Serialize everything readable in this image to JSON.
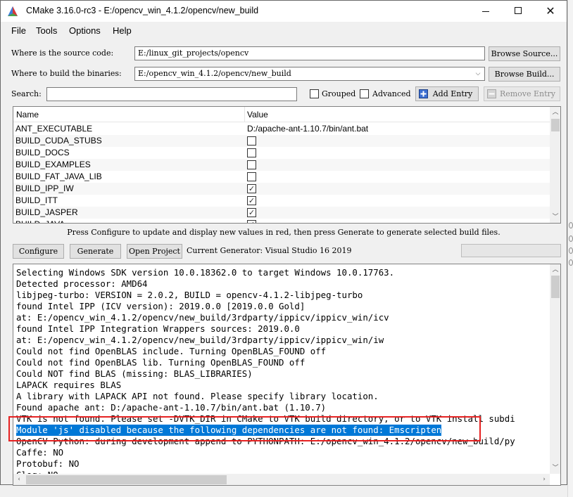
{
  "window": {
    "title": "CMake 3.16.0-rc3 - E:/opencv_win_4.1.2/opencv/new_build"
  },
  "menu": {
    "items": [
      "File",
      "Tools",
      "Options",
      "Help"
    ]
  },
  "source": {
    "label": "Where is the source code:",
    "value": "E:/linux_git_projects/opencv",
    "browse_label": "Browse Source..."
  },
  "build": {
    "label": "Where to build the binaries:",
    "value": "E:/opencv_win_4.1.2/opencv/new_build",
    "browse_label": "Browse Build..."
  },
  "search": {
    "label": "Search:",
    "value": ""
  },
  "options": {
    "grouped_label": "Grouped",
    "advanced_label": "Advanced",
    "add_entry_label": "Add Entry",
    "remove_entry_label": "Remove Entry"
  },
  "cache": {
    "col_name": "Name",
    "col_value": "Value",
    "rows": [
      {
        "name": "ANT_EXECUTABLE",
        "value": "D:/apache-ant-1.10.7/bin/ant.bat",
        "type": "path"
      },
      {
        "name": "BUILD_CUDA_STUBS",
        "checked": false,
        "type": "bool"
      },
      {
        "name": "BUILD_DOCS",
        "checked": false,
        "type": "bool"
      },
      {
        "name": "BUILD_EXAMPLES",
        "checked": false,
        "type": "bool"
      },
      {
        "name": "BUILD_FAT_JAVA_LIB",
        "checked": false,
        "type": "bool"
      },
      {
        "name": "BUILD_IPP_IW",
        "checked": true,
        "type": "bool"
      },
      {
        "name": "BUILD_ITT",
        "checked": true,
        "type": "bool"
      },
      {
        "name": "BUILD_JASPER",
        "checked": true,
        "type": "bool"
      },
      {
        "name": "BUILD_JAVA",
        "checked": true,
        "type": "bool"
      }
    ]
  },
  "hint": "Press Configure to update and display new values in red, then press Generate to generate selected build files.",
  "actions": {
    "configure_label": "Configure",
    "generate_label": "Generate",
    "open_project_label": "Open Project",
    "generator_text": "Current Generator: Visual Studio 16 2019"
  },
  "output": {
    "lines": [
      "Selecting Windows SDK version 10.0.18362.0 to target Windows 10.0.17763.",
      "Detected processor: AMD64",
      "libjpeg-turbo: VERSION = 2.0.2, BUILD = opencv-4.1.2-libjpeg-turbo",
      "found Intel IPP (ICV version): 2019.0.0 [2019.0.0 Gold]",
      "at: E:/opencv_win_4.1.2/opencv/new_build/3rdparty/ippicv/ippicv_win/icv",
      "found Intel IPP Integration Wrappers sources: 2019.0.0",
      "at: E:/opencv_win_4.1.2/opencv/new_build/3rdparty/ippicv/ippicv_win/iw",
      "Could not find OpenBLAS include. Turning OpenBLAS_FOUND off",
      "Could not find OpenBLAS lib. Turning OpenBLAS_FOUND off",
      "Could NOT find BLAS (missing: BLAS_LIBRARIES)",
      "LAPACK requires BLAS",
      "A library with LAPACK API not found. Please specify library location.",
      "Found apache ant: D:/apache-ant-1.10.7/bin/ant.bat (1.10.7)",
      "VTK is not found. Please set -DVTK_DIR in CMake to VTK build directory, or to VTK install subdi",
      "Module 'js' disabled because the following dependencies are not found: Emscripten",
      "OpenCV Python: during development append to PYTHONPATH: E:/opencv_win_4.1.2/opencv/new_build/py",
      "Caffe:   NO",
      "Protobuf:   NO",
      "Glog:   NO"
    ],
    "selected_index": 14
  },
  "colors": {
    "selection": "#0078d7",
    "annotation_box": "#e62222"
  }
}
